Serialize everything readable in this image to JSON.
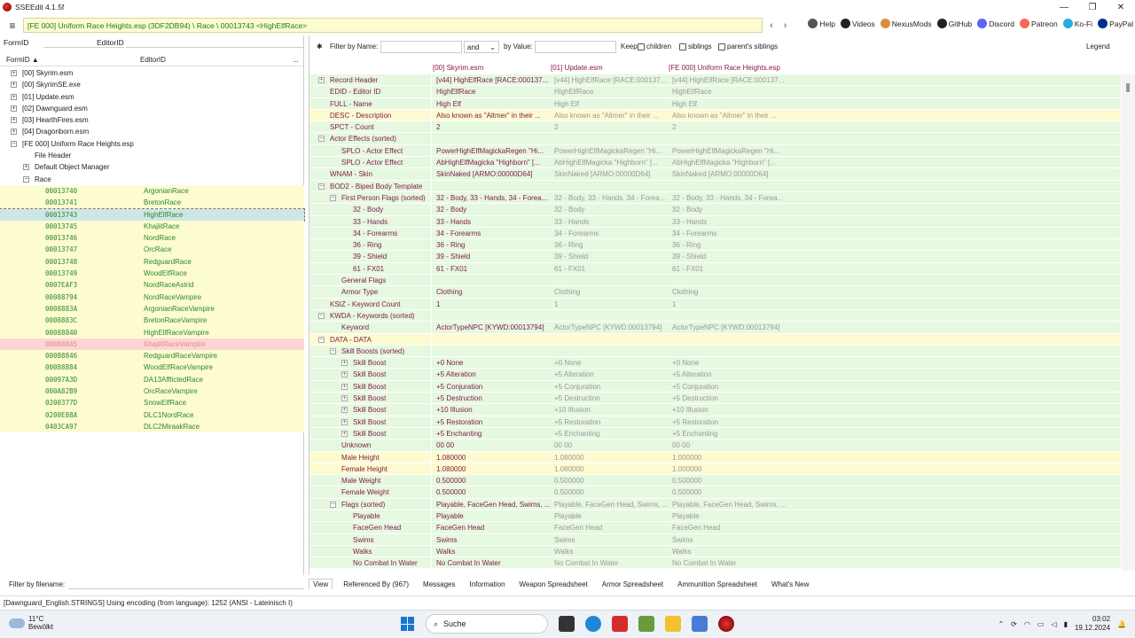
{
  "window": {
    "title": "SSEEdit 4.1.5f",
    "min": "—",
    "max": "❐",
    "close": "✕"
  },
  "path": "[FE 000] Uniform Race Heights.esp (3DF2DB94) \\ Race \\ 00013743 <HighElfRace>",
  "nav": {
    "back": "‹",
    "fwd": "›"
  },
  "links": [
    {
      "label": "Help",
      "icon": "book-icon"
    },
    {
      "label": "Videos",
      "icon": "video-icon"
    },
    {
      "label": "NexusMods",
      "icon": "nexus-icon"
    },
    {
      "label": "GitHub",
      "icon": "github-icon"
    },
    {
      "label": "Discord",
      "icon": "discord-icon"
    },
    {
      "label": "Patreon",
      "icon": "patreon-icon"
    },
    {
      "label": "Ko-Fi",
      "icon": "kofi-icon"
    },
    {
      "label": "PayPal",
      "icon": "paypal-icon"
    }
  ],
  "left": {
    "formid_label": "FormID",
    "editorid_label": "EditorID",
    "col_formid": "FormID ▲",
    "col_editorid": "EditorID",
    "col_more": "...",
    "tree": [
      {
        "label": "[00] Skyrim.esm",
        "level": 0,
        "exp": "+"
      },
      {
        "label": "[00] SkyrimSE.exe",
        "level": 0,
        "exp": "+"
      },
      {
        "label": "[01] Update.esm",
        "level": 0,
        "exp": "+"
      },
      {
        "label": "[02] Dawnguard.esm",
        "level": 0,
        "exp": "+"
      },
      {
        "label": "[03] HearthFires.esm",
        "level": 0,
        "exp": "+"
      },
      {
        "label": "[04] Dragonborn.esm",
        "level": 0,
        "exp": "+"
      },
      {
        "label": "[FE 000] Uniform Race Heights.esp",
        "level": 0,
        "exp": "−"
      },
      {
        "label": "File Header",
        "level": 1,
        "exp": ""
      },
      {
        "label": "Default Object Manager",
        "level": 1,
        "exp": "+"
      },
      {
        "label": "Race",
        "level": 1,
        "exp": "−"
      }
    ],
    "races": [
      {
        "fid": "00013740",
        "edid": "ArgonianRace",
        "state": ""
      },
      {
        "fid": "00013741",
        "edid": "BretonRace",
        "state": ""
      },
      {
        "fid": "00013743",
        "edid": "HighElfRace",
        "state": "sel"
      },
      {
        "fid": "00013745",
        "edid": "KhajiitRace",
        "state": ""
      },
      {
        "fid": "00013746",
        "edid": "NordRace",
        "state": ""
      },
      {
        "fid": "00013747",
        "edid": "OrcRace",
        "state": ""
      },
      {
        "fid": "00013748",
        "edid": "RedguardRace",
        "state": ""
      },
      {
        "fid": "00013749",
        "edid": "WoodElfRace",
        "state": ""
      },
      {
        "fid": "0007EAF3",
        "edid": "NordRaceAstrid",
        "state": ""
      },
      {
        "fid": "00088794",
        "edid": "NordRaceVampire",
        "state": ""
      },
      {
        "fid": "0008883A",
        "edid": "ArgonianRaceVampire",
        "state": ""
      },
      {
        "fid": "0008883C",
        "edid": "BretonRaceVampire",
        "state": ""
      },
      {
        "fid": "00088840",
        "edid": "HighElfRaceVampire",
        "state": ""
      },
      {
        "fid": "00088845",
        "edid": "KhajiitRaceVampire",
        "state": "red"
      },
      {
        "fid": "00088846",
        "edid": "RedguardRaceVampire",
        "state": ""
      },
      {
        "fid": "00088884",
        "edid": "WoodElfRaceVampire",
        "state": ""
      },
      {
        "fid": "00097A3D",
        "edid": "DA13AfflictedRace",
        "state": ""
      },
      {
        "fid": "000A82B9",
        "edid": "OrcRaceVampire",
        "state": ""
      },
      {
        "fid": "0200377D",
        "edid": "SnowElfRace",
        "state": ""
      },
      {
        "fid": "0200E88A",
        "edid": "DLC1NordRace",
        "state": ""
      },
      {
        "fid": "0403CA97",
        "edid": "DLC2MiraakRace",
        "state": ""
      }
    ],
    "filter_label": "Filter by filename:"
  },
  "filter": {
    "pin": "✱",
    "by_name": "Filter by Name:",
    "and": "and",
    "by_value": "by Value:",
    "keep": "Keep",
    "children": "children",
    "siblings": "siblings",
    "parents": "parent's siblings",
    "legend": "Legend"
  },
  "headers": [
    "[00] Skyrim.esm",
    "[01] Update.esm",
    "[FE 000] Uniform Race Heights.esp"
  ],
  "rows": [
    {
      "n": "Record Header",
      "l": 0,
      "e": "+",
      "v": [
        "[v44] HighElfRace [RACE:000137...",
        "[v44] HighElfRace [RACE:000137...",
        "[v44] HighElfRace [RACE:000137..."
      ]
    },
    {
      "n": "EDID - Editor ID",
      "l": 0,
      "e": "",
      "v": [
        "HighElfRace",
        "HighElfRace",
        "HighElfRace"
      ]
    },
    {
      "n": "FULL - Name",
      "l": 0,
      "e": "",
      "v": [
        "High Elf",
        "High Elf",
        "High Elf"
      ]
    },
    {
      "n": "DESC - Description",
      "l": 0,
      "e": "",
      "y": true,
      "v": [
        "Also known as \"Altmer\" in their ...",
        "Also known as \"Altmer\" in their ...",
        "Also known as \"Altmer\" in their ..."
      ]
    },
    {
      "n": "SPCT - Count",
      "l": 0,
      "e": "",
      "v": [
        "2",
        "2",
        "2"
      ]
    },
    {
      "n": "Actor Effects (sorted)",
      "l": 0,
      "e": "−",
      "v": [
        "",
        "",
        ""
      ]
    },
    {
      "n": "SPLO - Actor Effect",
      "l": 1,
      "e": "",
      "v": [
        "PowerHighElfMagickaRegen \"Hi...",
        "PowerHighElfMagickaRegen \"Hi...",
        "PowerHighElfMagickaRegen \"Hi..."
      ]
    },
    {
      "n": "SPLO - Actor Effect",
      "l": 1,
      "e": "",
      "v": [
        "AbHighElfMagicka \"Highborn\" [...",
        "AbHighElfMagicka \"Highborn\" [...",
        "AbHighElfMagicka \"Highborn\" [..."
      ]
    },
    {
      "n": "WNAM - Skin",
      "l": 0,
      "e": "",
      "v": [
        "SkinNaked [ARMO:00000D64]",
        "SkinNaked [ARMO:00000D64]",
        "SkinNaked [ARMO:00000D64]"
      ]
    },
    {
      "n": "BOD2 - Biped Body Template",
      "l": 0,
      "e": "−",
      "v": [
        "",
        "",
        ""
      ]
    },
    {
      "n": "First Person Flags (sorted)",
      "l": 1,
      "e": "−",
      "v": [
        "32 - Body, 33 - Hands, 34 - Forea...",
        "32 - Body, 33 - Hands, 34 - Forea...",
        "32 - Body, 33 - Hands, 34 - Forea..."
      ]
    },
    {
      "n": "32 - Body",
      "l": 2,
      "e": "",
      "v": [
        "32 - Body",
        "32 - Body",
        "32 - Body"
      ]
    },
    {
      "n": "33 - Hands",
      "l": 2,
      "e": "",
      "v": [
        "33 - Hands",
        "33 - Hands",
        "33 - Hands"
      ]
    },
    {
      "n": "34 - Forearms",
      "l": 2,
      "e": "",
      "v": [
        "34 - Forearms",
        "34 - Forearms",
        "34 - Forearms"
      ]
    },
    {
      "n": "36 - Ring",
      "l": 2,
      "e": "",
      "v": [
        "36 - Ring",
        "36 - Ring",
        "36 - Ring"
      ]
    },
    {
      "n": "39 - Shield",
      "l": 2,
      "e": "",
      "v": [
        "39 - Shield",
        "39 - Shield",
        "39 - Shield"
      ]
    },
    {
      "n": "61 - FX01",
      "l": 2,
      "e": "",
      "v": [
        "61 - FX01",
        "61 - FX01",
        "61 - FX01"
      ]
    },
    {
      "n": "General Flags",
      "l": 1,
      "e": "",
      "v": [
        "",
        "",
        ""
      ]
    },
    {
      "n": "Armor Type",
      "l": 1,
      "e": "",
      "v": [
        "Clothing",
        "Clothing",
        "Clothing"
      ]
    },
    {
      "n": "KSIZ - Keyword Count",
      "l": 0,
      "e": "",
      "v": [
        "1",
        "1",
        "1"
      ]
    },
    {
      "n": "KWDA - Keywords (sorted)",
      "l": 0,
      "e": "−",
      "v": [
        "",
        "",
        ""
      ]
    },
    {
      "n": "Keyword",
      "l": 1,
      "e": "",
      "v": [
        "ActorTypeNPC [KYWD:00013794]",
        "ActorTypeNPC [KYWD:00013794]",
        "ActorTypeNPC [KYWD:00013794]"
      ]
    },
    {
      "n": "DATA - DATA",
      "l": 0,
      "e": "−",
      "y": true,
      "v": [
        "",
        "",
        ""
      ]
    },
    {
      "n": "Skill Boosts (sorted)",
      "l": 1,
      "e": "−",
      "v": [
        "",
        "",
        ""
      ]
    },
    {
      "n": "Skill Boost",
      "l": 2,
      "e": "+",
      "v": [
        "+0 None",
        "+0 None",
        "+0 None"
      ]
    },
    {
      "n": "Skill Boost",
      "l": 2,
      "e": "+",
      "v": [
        "+5 Alteration",
        "+5 Alteration",
        "+5 Alteration"
      ]
    },
    {
      "n": "Skill Boost",
      "l": 2,
      "e": "+",
      "v": [
        "+5 Conjuration",
        "+5 Conjuration",
        "+5 Conjuration"
      ]
    },
    {
      "n": "Skill Boost",
      "l": 2,
      "e": "+",
      "v": [
        "+5 Destruction",
        "+5 Destruction",
        "+5 Destruction"
      ]
    },
    {
      "n": "Skill Boost",
      "l": 2,
      "e": "+",
      "v": [
        "+10 Illusion",
        "+10 Illusion",
        "+10 Illusion"
      ]
    },
    {
      "n": "Skill Boost",
      "l": 2,
      "e": "+",
      "v": [
        "+5 Restoration",
        "+5 Restoration",
        "+5 Restoration"
      ]
    },
    {
      "n": "Skill Boost",
      "l": 2,
      "e": "+",
      "v": [
        "+5 Enchanting",
        "+5 Enchanting",
        "+5 Enchanting"
      ]
    },
    {
      "n": "Unknown",
      "l": 1,
      "e": "",
      "v": [
        "00 00",
        "00 00",
        "00 00"
      ]
    },
    {
      "n": "Male Height",
      "l": 1,
      "e": "",
      "y": true,
      "v": [
        "1.080000",
        "1.080000",
        "1.000000"
      ]
    },
    {
      "n": "Female Height",
      "l": 1,
      "e": "",
      "y": true,
      "v": [
        "1.080000",
        "1.080000",
        "1.000000"
      ]
    },
    {
      "n": "Male Weight",
      "l": 1,
      "e": "",
      "v": [
        "0.500000",
        "0.500000",
        "0.500000"
      ]
    },
    {
      "n": "Female Weight",
      "l": 1,
      "e": "",
      "v": [
        "0.500000",
        "0.500000",
        "0.500000"
      ]
    },
    {
      "n": "Flags (sorted)",
      "l": 1,
      "e": "−",
      "v": [
        "Playable, FaceGen Head, Swims, ...",
        "Playable, FaceGen Head, Swims, ...",
        "Playable, FaceGen Head, Swims, ..."
      ]
    },
    {
      "n": "Playable",
      "l": 2,
      "e": "",
      "v": [
        "Playable",
        "Playable",
        "Playable"
      ]
    },
    {
      "n": "FaceGen Head",
      "l": 2,
      "e": "",
      "v": [
        "FaceGen Head",
        "FaceGen Head",
        "FaceGen Head"
      ]
    },
    {
      "n": "Swims",
      "l": 2,
      "e": "",
      "v": [
        "Swims",
        "Swims",
        "Swims"
      ]
    },
    {
      "n": "Walks",
      "l": 2,
      "e": "",
      "v": [
        "Walks",
        "Walks",
        "Walks"
      ]
    },
    {
      "n": "No Combat In Water",
      "l": 2,
      "e": "",
      "v": [
        "No Combat In Water",
        "No Combat In Water",
        "No Combat In Water"
      ]
    }
  ],
  "tabs": [
    "View",
    "Referenced By (967)",
    "Messages",
    "Information",
    "Weapon Spreadsheet",
    "Armor Spreadsheet",
    "Ammunition Spreadsheet",
    "What's New"
  ],
  "status": "[Dawnguard_English.STRINGS] Using encoding (from language): 1252  (ANSI - Lateinisch I)",
  "taskbar": {
    "temp": "11°C",
    "weather": "Bewölkt",
    "search": "Suche",
    "time": "03:02",
    "date": "19.12.2024"
  }
}
